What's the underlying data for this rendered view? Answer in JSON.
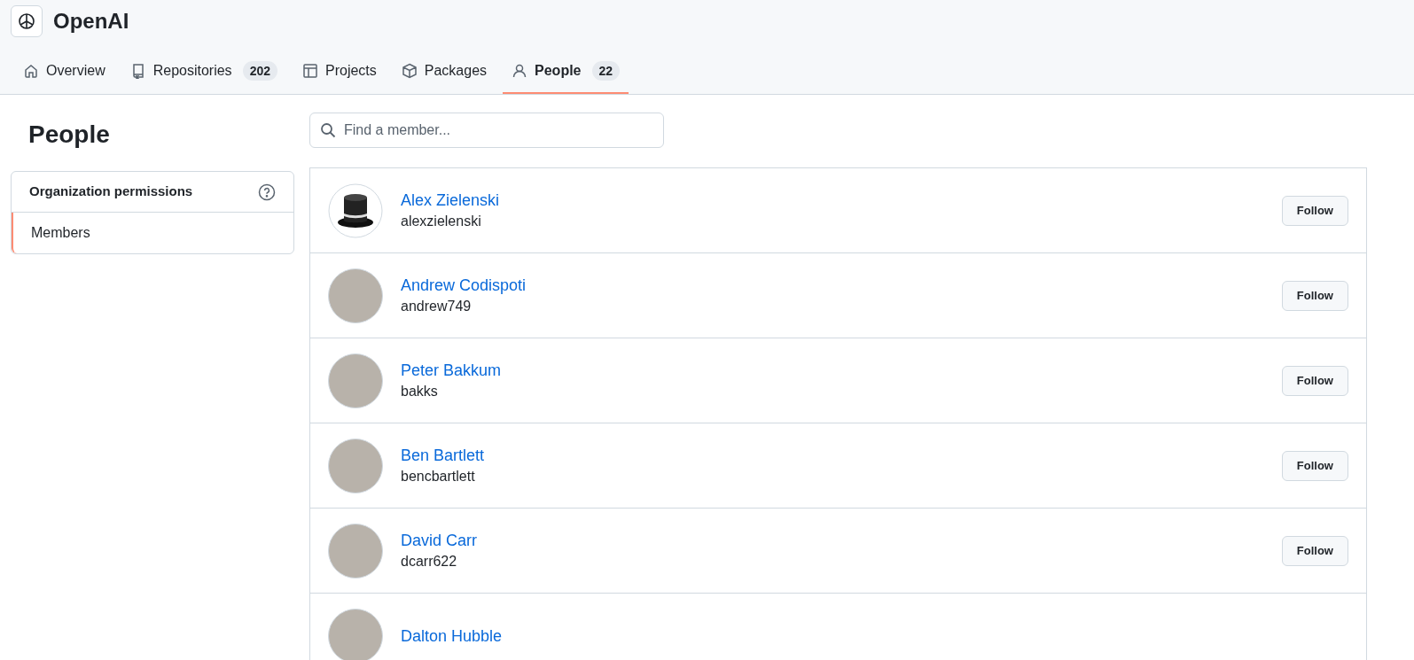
{
  "org": {
    "name": "OpenAI"
  },
  "tabs": [
    {
      "label": "Overview",
      "selected": false
    },
    {
      "label": "Repositories",
      "count": "202",
      "selected": false
    },
    {
      "label": "Projects",
      "selected": false
    },
    {
      "label": "Packages",
      "selected": false
    },
    {
      "label": "People",
      "count": "22",
      "selected": true
    }
  ],
  "page_title": "People",
  "sidebar": {
    "heading": "Organization permissions",
    "items": [
      {
        "label": "Members",
        "selected": true
      }
    ]
  },
  "search": {
    "placeholder": "Find a member..."
  },
  "members": [
    {
      "name": "Alex Zielenski",
      "login": "alexzielenski",
      "kind": "hat",
      "button": "Follow"
    },
    {
      "name": "Andrew Codispoti",
      "login": "andrew749",
      "kind": "photo",
      "button": "Follow"
    },
    {
      "name": "Peter Bakkum",
      "login": "bakks",
      "kind": "photo",
      "button": "Follow"
    },
    {
      "name": "Ben Bartlett",
      "login": "bencbartlett",
      "kind": "photo",
      "button": "Follow"
    },
    {
      "name": "David Carr",
      "login": "dcarr622",
      "kind": "photo",
      "button": "Follow"
    },
    {
      "name": "Dalton Hubble",
      "kind": "photo"
    }
  ]
}
